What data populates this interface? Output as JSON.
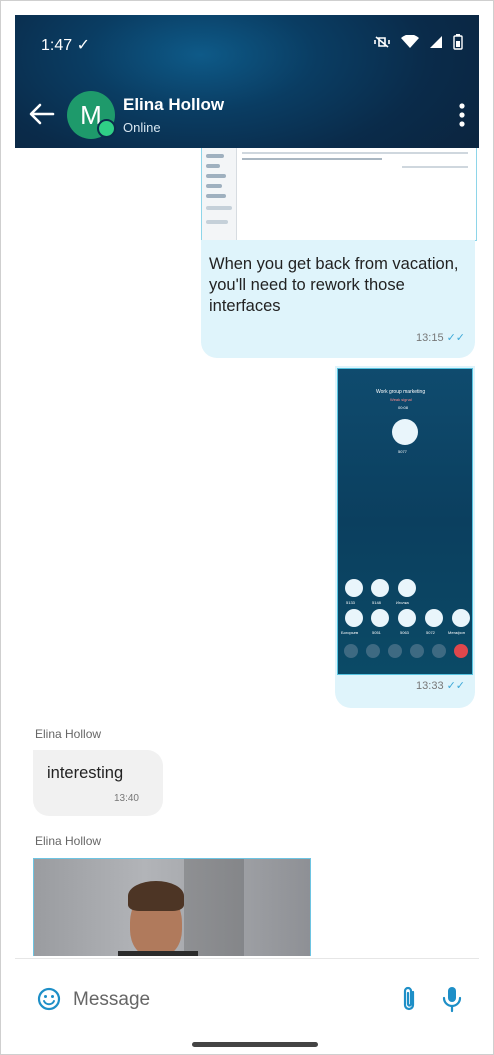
{
  "status_bar": {
    "time": "1:47",
    "check": "✓"
  },
  "header": {
    "avatar_initial": "M",
    "contact_name": "Elina Hollow",
    "contact_status": "Online"
  },
  "messages": [
    {
      "type": "outgoing",
      "text": "When you get back from vacation, you'll need to rework those interfaces",
      "time": "13:15"
    },
    {
      "type": "outgoing_image",
      "time": "13:33"
    },
    {
      "type": "incoming",
      "sender": "Elina Hollow",
      "text": "interesting",
      "time": "13:40"
    },
    {
      "type": "incoming_image",
      "sender": "Elina Hollow"
    }
  ],
  "embedded_call_screen": {
    "title": "Work group marketing",
    "subtitle": "Weak signal",
    "timer": "00:08",
    "count": "5077",
    "participants": [
      "5133",
      "5148",
      "Иголка",
      "Богорьев",
      "5051",
      "5063",
      "5072",
      "Мегафон"
    ]
  },
  "input": {
    "placeholder": "Message"
  },
  "colors": {
    "accent": "#1e8fc7",
    "avatar": "#1e9a6b",
    "outgoing_bubble": "#dff4fb",
    "incoming_bubble": "#f1f1f1"
  }
}
